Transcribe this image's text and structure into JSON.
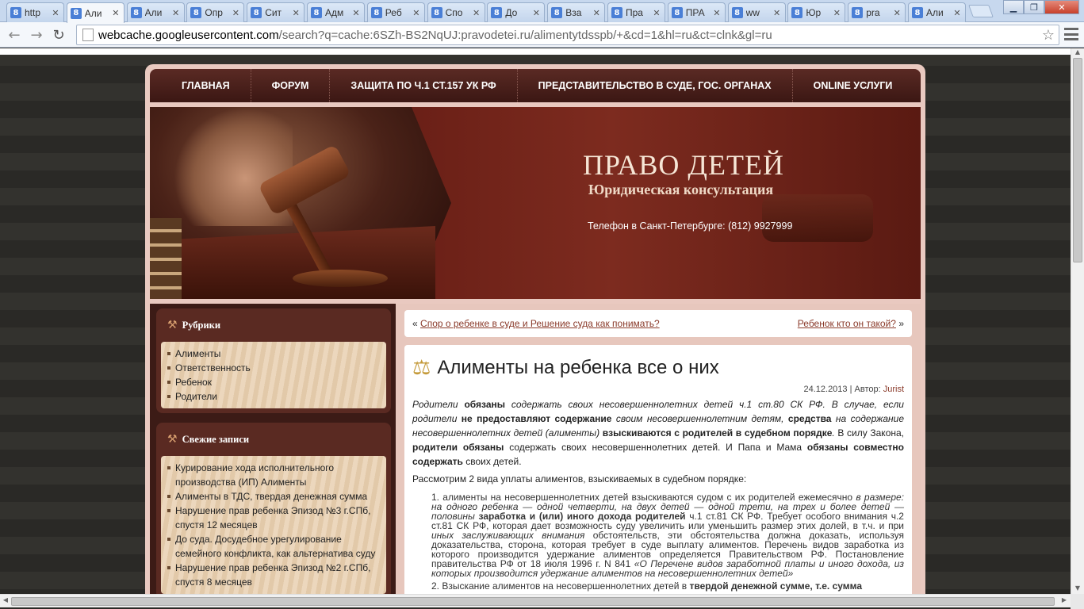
{
  "browser": {
    "tabs": [
      {
        "label": "http",
        "active": false
      },
      {
        "label": "Али",
        "active": true
      },
      {
        "label": "Али",
        "active": false
      },
      {
        "label": "Опр",
        "active": false
      },
      {
        "label": "Сит",
        "active": false
      },
      {
        "label": "Адм",
        "active": false
      },
      {
        "label": "Реб",
        "active": false
      },
      {
        "label": "Спо",
        "active": false
      },
      {
        "label": "До",
        "active": false
      },
      {
        "label": "Вза",
        "active": false
      },
      {
        "label": "Пра",
        "active": false
      },
      {
        "label": "ПРА",
        "active": false
      },
      {
        "label": "ww",
        "active": false
      },
      {
        "label": "Юр",
        "active": false
      },
      {
        "label": "pra",
        "active": false
      },
      {
        "label": "Али",
        "active": false
      }
    ],
    "tab_favicon": "8",
    "url_host": "webcache.googleusercontent.com",
    "url_rest": "/search?q=cache:6SZh-BS2NqUJ:pravodetei.ru/alimentytdsspb/+&cd=1&hl=ru&ct=clnk&gl=ru",
    "icons": {
      "back": "←",
      "forward": "→",
      "reload": "↻",
      "star": "☆",
      "close_tab": "✕",
      "minimize": "▁",
      "maximize": "❐",
      "close_window": "✕"
    }
  },
  "nav": {
    "items": [
      "ГЛАВНАЯ",
      "ФОРУМ",
      "ЗАЩИТА ПО Ч.1 СТ.157 УК РФ",
      "ПРЕДСТАВИТЕЛЬСТВО В СУДЕ, ГОС. ОРГАНАХ",
      "ONLINE УСЛУГИ"
    ]
  },
  "banner": {
    "title": "ПРАВО ДЕТЕЙ",
    "subtitle": "Юридическая консультация",
    "phone": "Телефон в Санкт-Петербурге: (812) 9927999"
  },
  "sidebar": {
    "rubrics": {
      "title": "Рубрики",
      "items": [
        "Алименты",
        "Ответственность",
        "Ребенок",
        "Родители"
      ]
    },
    "recent": {
      "title": "Свежие записи",
      "items": [
        "Курирование хода исполнительного производства (ИП) Алименты",
        "Алименты в ТДС, твердая денежная сумма",
        "Нарушение прав ребенка Эпизод №3 г.СПб, спустя 12 месяцев",
        "До суда. Досудебное урегулирование семейного конфликта, как альтернатива суду",
        "Нарушение прав ребенка Эпизод №2 г.СПб, спустя 8 месяцев"
      ]
    }
  },
  "postnav": {
    "prev_label": "Спор о ребенке в суде и Решение суда как понимать?",
    "next_label": "Ребенок кто он такой?",
    "laquo": "«",
    "raquo": "»"
  },
  "post": {
    "title": "Алименты на ребенка все о них",
    "date": "24.12.2013",
    "author_prefix": " | Автор: ",
    "author": "Jurist",
    "intro": {
      "p1": "Родители ",
      "b1": "обязаны",
      "p2": " содержать своих несовершеннолетних детей ч.1 ст.80 СК РФ. В случае, если родители ",
      "b2": "не предоставляют содержание",
      "p3": " своим несовершеннолетним детям, ",
      "b3": "средства",
      "p4": " на содержание несовершеннолетних детей (алименты) ",
      "b4": "взыскиваются с родителей в судебном порядке",
      "p5": "."
    },
    "law": {
      "p1": " В силу Закона, ",
      "b1": "родители обязаны",
      "p2": " содержать своих несовершеннолетних детей. И Папа и Мама ",
      "b2": "обязаны совместно содержать",
      "p3": " своих детей."
    },
    "lead": "Рассмотрим 2 вида уплаты алиментов, взыскиваемых в судебном порядке:",
    "item1": {
      "num": "1.",
      "t1": " алименты на несовершеннолетних детей взыскиваются судом с их родителей ежемесячно ",
      "i1": "в размере: на одного ребенка — одной четверти, на двух детей — одной трети, на трех и более детей — половины",
      "b1": " заработка и (или) иного дохода родителей",
      "t2": " ч.1 ст.81 СК РФ.  Требует особого внимания ч.2 ст.81 СК РФ, которая дает возможность суду увеличить или уменьшить размер этих долей, в т.ч. и при ",
      "i2": "иных заслуживающих внимания",
      "t3": " обстоятельств, эти обстоятельства должна доказать, используя доказательства, сторона, которая требует в суде выплату алиментов. Перечень видов заработка из которого производится удержание алиментов определяется Правительством РФ. Постановление правительства РФ от 18 июля 1996 г. N 841 ",
      "i3": "«О Перечене видов заработной платы и иного дохода, из которых производится удержание алиментов на несовершеннолетних детей»"
    },
    "item2": {
      "num": "2.",
      "t1": " Взыскание алиментов на несовершеннолетних детей в ",
      "b1": "твердой денежной сумме, т.е. сумма"
    }
  },
  "colors": {
    "nav_bg": "#3b1713",
    "site_bg": "#e9c9c0",
    "link": "#8a3a2a",
    "banner_title": "#f6e6d6"
  }
}
